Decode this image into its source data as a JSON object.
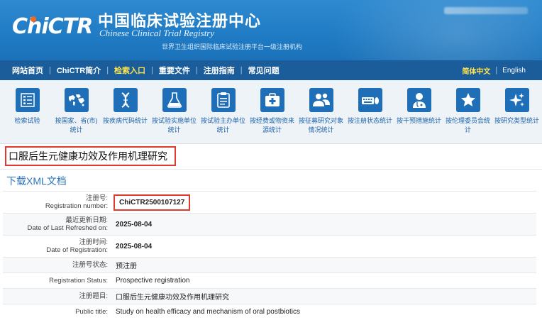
{
  "header": {
    "logo_text": "ChiCTR",
    "title_cn": "中国临床试验注册中心",
    "title_en": "Chinese Clinical Trial Registry",
    "subtitle": "世界卫生组织国际临床试验注册平台一级注册机构"
  },
  "nav": {
    "items": [
      {
        "label": "网站首页",
        "active": false
      },
      {
        "label": "ChiCTR简介",
        "active": false
      },
      {
        "label": "检索入口",
        "active": true
      },
      {
        "label": "重要文件",
        "active": false
      },
      {
        "label": "注册指南",
        "active": false
      },
      {
        "label": "常见问题",
        "active": false
      }
    ],
    "lang_cn": "简体中文",
    "lang_en": "English"
  },
  "toolbar": {
    "items": [
      {
        "label": "检索试验",
        "icon": "list-icon"
      },
      {
        "label": "按国家、省(市)统计",
        "icon": "world-map-icon"
      },
      {
        "label": "按疾病代码统计",
        "icon": "dna-icon"
      },
      {
        "label": "按试验实施单位统计",
        "icon": "flask-icon"
      },
      {
        "label": "按试验主办单位统计",
        "icon": "clipboard-icon"
      },
      {
        "label": "按经费或物资来源统计",
        "icon": "medkit-icon"
      },
      {
        "label": "按征募研究对象情况统计",
        "icon": "people-icon"
      },
      {
        "label": "按注册状态统计",
        "icon": "keyboard-mouse-icon"
      },
      {
        "label": "按干预措施统计",
        "icon": "doctor-icon"
      },
      {
        "label": "按伦理委员会统计",
        "icon": "star-icon"
      },
      {
        "label": "按研究类型统计",
        "icon": "sparkles-icon"
      }
    ]
  },
  "study": {
    "title": "口服后生元健康功效及作用机理研究",
    "xml_link": "下载XML文档"
  },
  "info": {
    "reg_number_label_cn": "注册号:",
    "reg_number_label_en": "Registration number:",
    "reg_number": "ChiCTR2500107127",
    "refreshed_label_cn": "最近更新日期:",
    "refreshed_label_en": "Date of Last Refreshed on:",
    "refreshed": "2025-08-04",
    "reg_date_label_cn": "注册时间:",
    "reg_date_label_en": "Date of Registration:",
    "reg_date": "2025-08-04",
    "status_label_cn": "注册号状态:",
    "status_cn": "预注册",
    "status_label_en": "Registration Status:",
    "status_en": "Prospective registration",
    "title_label_cn": "注册题目:",
    "title_cn": "口服后生元健康功效及作用机理研究",
    "title_label_en": "Public title:",
    "title_en": "Study on health efficacy and mechanism of oral postbiotics"
  }
}
